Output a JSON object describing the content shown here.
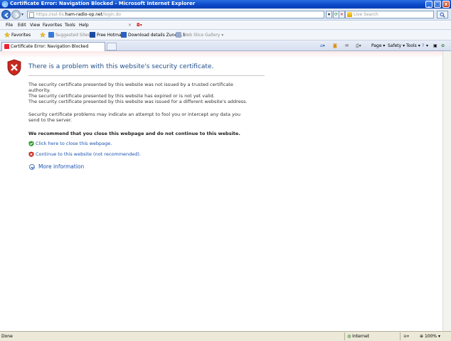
{
  "window": {
    "title": "Certificate Error: Navigation Blocked - Microsoft Internet Explorer",
    "min_label": "_",
    "max_label": "□",
    "close_label": "x"
  },
  "address_bar": {
    "url_prefix": "https://ssl-tls.",
    "url_domain": "ham-radio-op.net",
    "url_suffix": "/login.do",
    "search_placeholder": "Live Search"
  },
  "menu": [
    "File",
    "Edit",
    "View",
    "Favorites",
    "Tools",
    "Help"
  ],
  "favorites_bar": {
    "favorites_label": "Favorites",
    "items": [
      "Suggested Sites ▾",
      "Free Hotmail",
      "Download details Zune 3.1",
      "Web Slice Gallery ▾"
    ]
  },
  "tab": {
    "label": "Certificate Error: Navigation Blocked"
  },
  "command_bar": {
    "page": "Page ▾",
    "safety": "Safety ▾",
    "tools": "Tools ▾",
    "help": "▾"
  },
  "content": {
    "heading": "There is a problem with this website's security certificate.",
    "para1_line1": "The security certificate presented by this website was not issued by a trusted certificate",
    "para1_line2": "authority.",
    "para1_line3": "The security certificate presented by this website has expired or is not yet valid.",
    "para1_line4": "The security certificate presented by this website was issued for a different website's address.",
    "para2_line1": "Security certificate problems may indicate an attempt to fool you or intercept any data you",
    "para2_line2": "send to the server.",
    "recommend": "We recommend that you close this webpage and do not continue to this website.",
    "close_link": "Click here to close this webpage.",
    "continue_link": "Continue to this website (not recommended).",
    "more_info": "More information"
  },
  "status_bar": {
    "status": "Done",
    "zone": "Internet",
    "zoom": "100%"
  }
}
